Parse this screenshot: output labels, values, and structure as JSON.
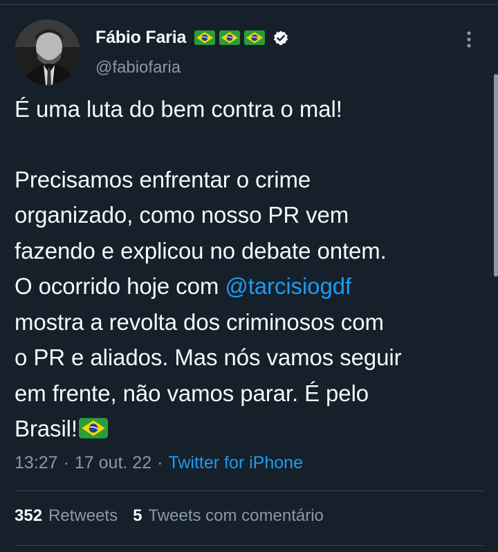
{
  "author": {
    "display_name": "Fábio Faria",
    "handle": "@fabiofaria",
    "flag_icons": [
      "brazil-flag-icon",
      "brazil-flag-icon",
      "brazil-flag-icon"
    ],
    "verified_icon": "verified-badge-icon"
  },
  "tweet": {
    "lines": {
      "l1": "É uma luta do bem contra o mal!",
      "l2": "Precisamos enfrentar o crime",
      "l3": "organizado, como nosso PR vem",
      "l4": "fazendo e explicou no debate ontem.",
      "l5_prefix": "O ocorrido hoje com ",
      "l5_mention": "@tarcisiogdf",
      "l6": "mostra a revolta dos criminosos com",
      "l7": "o PR e aliados. Mas nós vamos seguir",
      "l8": "em frente, não vamos parar. É pelo",
      "l9": "Brasil!"
    },
    "trailing_icon": "brazil-flag-icon"
  },
  "meta": {
    "time": "13:27",
    "separator": "·",
    "date": "17 out. 22",
    "source": "Twitter for iPhone"
  },
  "stats": {
    "retweets_count": "352",
    "retweets_label": "Retweets",
    "quotes_count": "5",
    "quotes_label": "Tweets com comentário"
  },
  "colors": {
    "background": "#15202b",
    "text": "#f7f9f9",
    "secondary": "#8b98a5",
    "accent": "#1d9bf0",
    "divider": "#38444d"
  }
}
